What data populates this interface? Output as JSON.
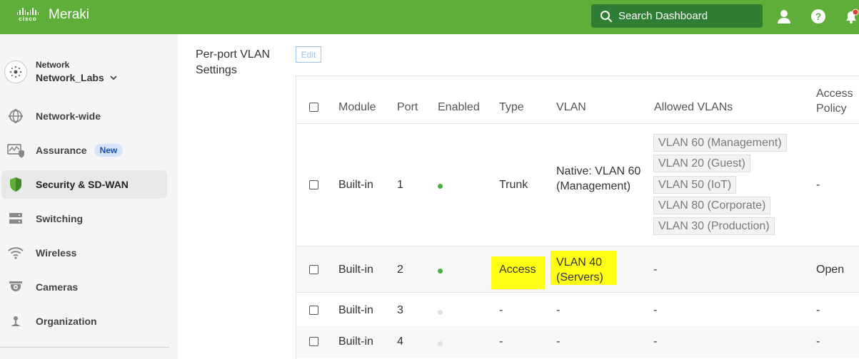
{
  "header": {
    "cisco_text": "cisco",
    "brand": "Meraki",
    "search_label": "Search Dashboard",
    "accent_color": "#5fae3a"
  },
  "sidebar": {
    "network_label": "Network",
    "network_name": "Network_Labs",
    "items": [
      {
        "label": "Network-wide",
        "icon": "globe-icon"
      },
      {
        "label": "Assurance",
        "icon": "assurance-icon",
        "badge": "New"
      },
      {
        "label": "Security & SD-WAN",
        "icon": "shield-icon",
        "active": true
      },
      {
        "label": "Switching",
        "icon": "switch-icon"
      },
      {
        "label": "Wireless",
        "icon": "wifi-icon"
      },
      {
        "label": "Cameras",
        "icon": "camera-icon"
      },
      {
        "label": "Organization",
        "icon": "organization-icon"
      }
    ]
  },
  "main": {
    "section_title": "Per-port VLAN Settings",
    "edit_label": "Edit",
    "columns": [
      "Module",
      "Port",
      "Enabled",
      "Type",
      "VLAN",
      "Allowed VLANs",
      "Access Policy"
    ],
    "rows": [
      {
        "module": "Built-in",
        "port": "1",
        "enabled": true,
        "type": "Trunk",
        "vlan": "Native: VLAN 60 (Management)",
        "allowed": [
          "VLAN 60 (Management)",
          "VLAN 20 (Guest)",
          "VLAN 50 (IoT)",
          "VLAN 80 (Corporate)",
          "VLAN 30 (Production)"
        ],
        "policy": "-"
      },
      {
        "module": "Built-in",
        "port": "2",
        "enabled": true,
        "type": "Access",
        "vlan": "VLAN 40 (Servers)",
        "allowed_text": "-",
        "policy": "Open",
        "highlighted": true
      },
      {
        "module": "Built-in",
        "port": "3",
        "enabled": false,
        "type": "-",
        "vlan": "-",
        "allowed_text": "-",
        "policy": "-"
      },
      {
        "module": "Built-in",
        "port": "4",
        "enabled": false,
        "type": "-",
        "vlan": "-",
        "allowed_text": "-",
        "policy": "-"
      }
    ],
    "enabled_color": "#4caf3f",
    "disabled_color": "#e0e0e0",
    "highlight_color": "#ffff14"
  }
}
